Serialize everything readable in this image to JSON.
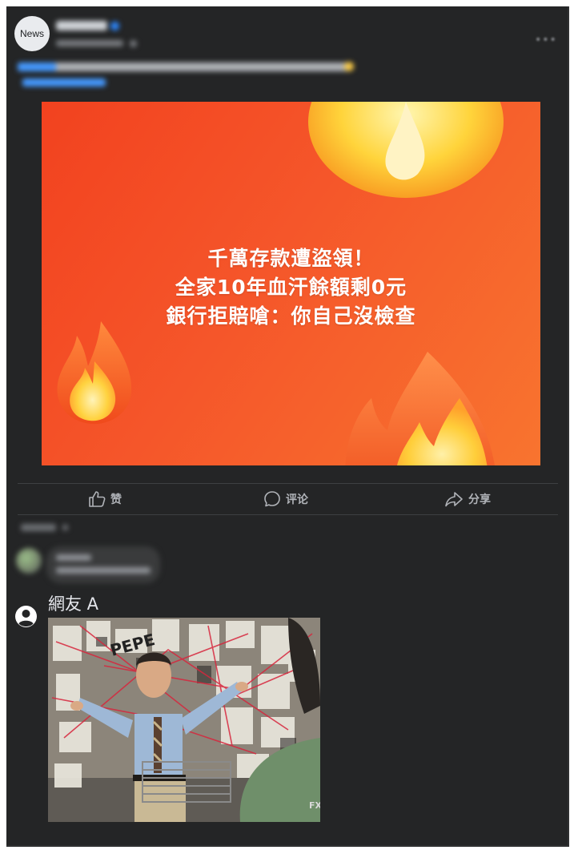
{
  "post": {
    "avatar_label": "News",
    "hero_lines": [
      "千萬存款遭盜領！",
      "全家10年血汗餘額剩0元",
      "銀行拒賠嗆：你自己沒檢查"
    ]
  },
  "actions": [
    {
      "label": "赞",
      "icon": "thumbs-up-icon"
    },
    {
      "label": "评论",
      "icon": "comment-icon"
    },
    {
      "label": "分享",
      "icon": "share-icon"
    }
  ],
  "comments": [
    {
      "name": "網友 A",
      "avatar_icon": "user-icon"
    }
  ],
  "colors": {
    "card_bg": "#242526",
    "hero_orange": "#f5562a",
    "text_secondary": "#b0b3b8",
    "link_blue": "#4599ff"
  }
}
